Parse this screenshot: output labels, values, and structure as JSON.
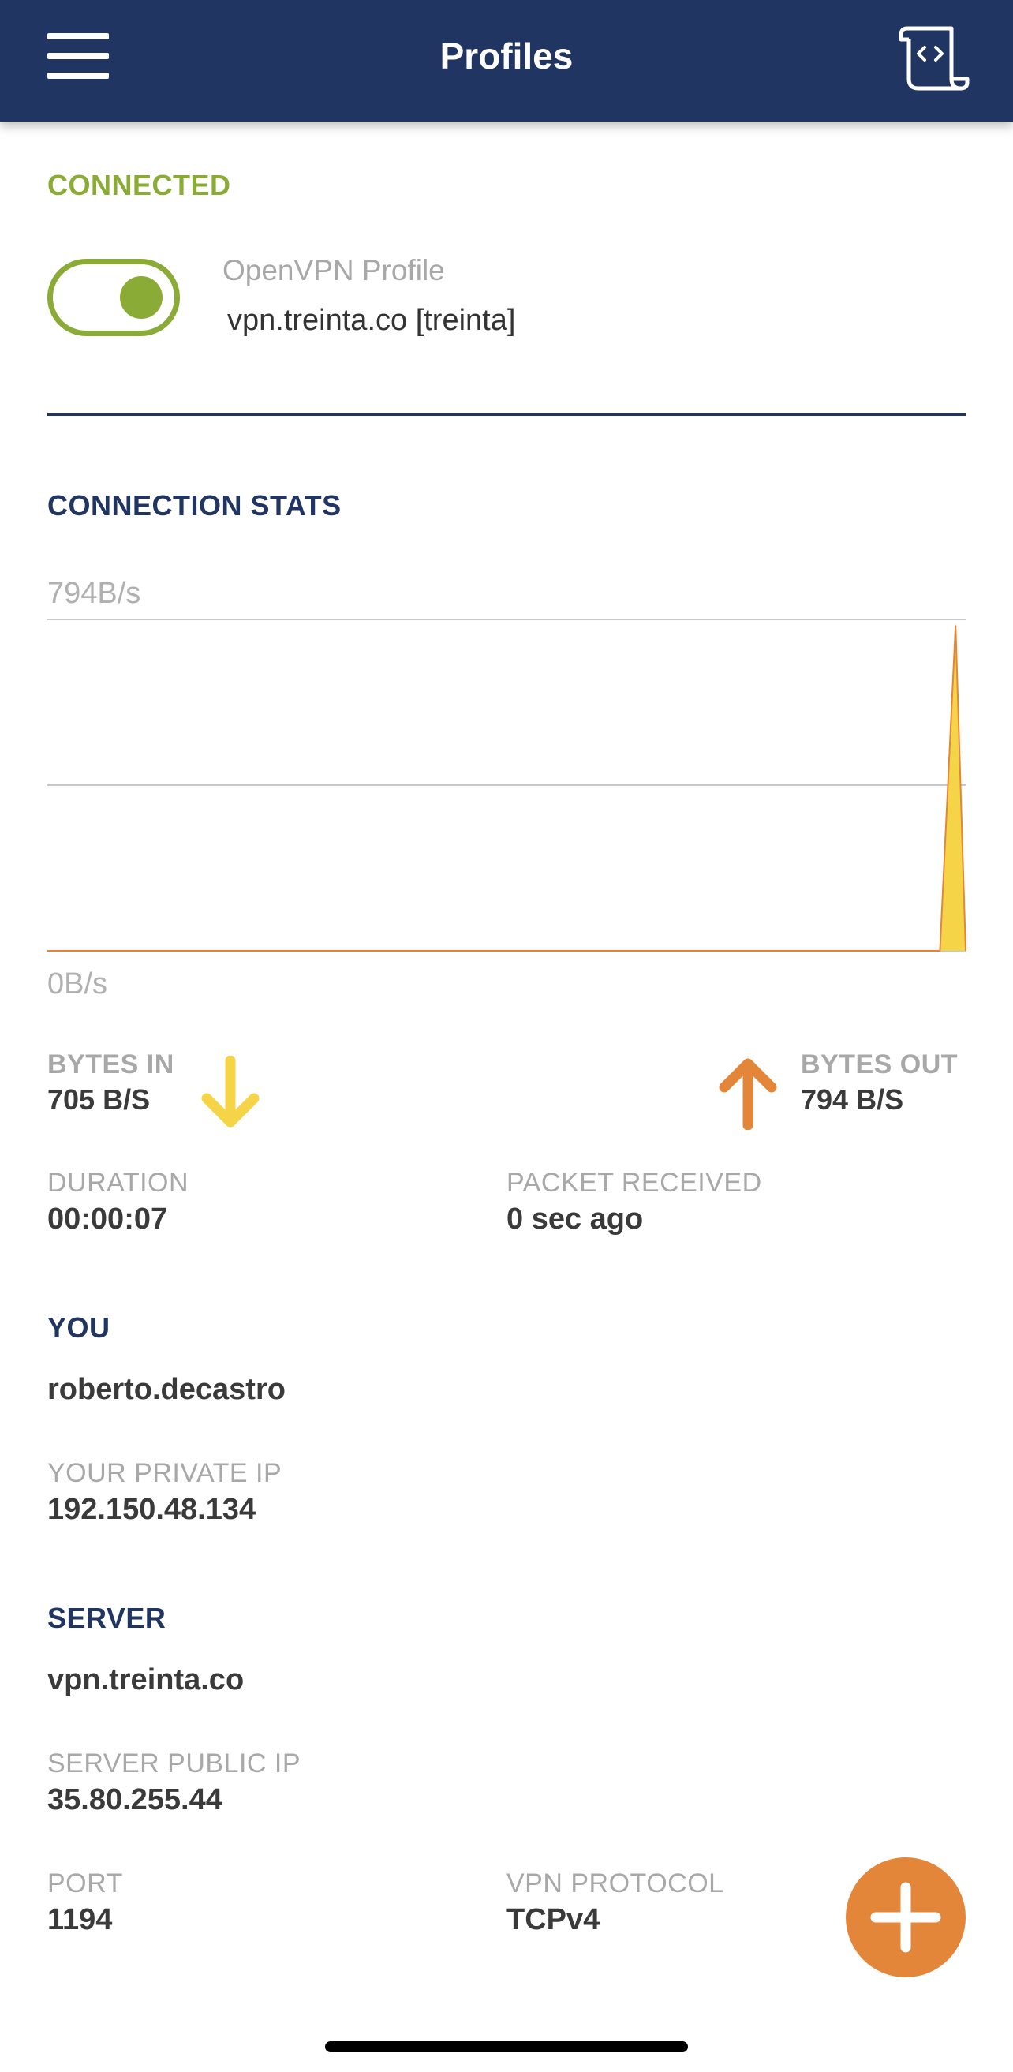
{
  "header": {
    "title": "Profiles"
  },
  "connection": {
    "status": "CONNECTED",
    "status_color": "#8aab35",
    "toggle_on": true,
    "profile_type": "OpenVPN Profile",
    "profile_name": "vpn.treinta.co [treinta]"
  },
  "stats": {
    "heading": "CONNECTION STATS",
    "max_label": "794B/s",
    "min_label": "0B/s",
    "bytes_in_label": "BYTES IN",
    "bytes_in_value": "705 B/S",
    "bytes_out_label": "BYTES OUT",
    "bytes_out_value": "794 B/S",
    "duration_label": "DURATION",
    "duration_value": "00:00:07",
    "packet_label": "PACKET RECEIVED",
    "packet_value": "0 sec ago"
  },
  "chart_data": {
    "type": "area",
    "ylim": [
      0,
      794
    ],
    "ytick_labels": [
      "794B/s",
      "0B/s"
    ],
    "grid": true,
    "series": [
      {
        "color": "#f5d547",
        "points": [
          {
            "t": 0.0,
            "v": 0
          },
          {
            "t": 0.972,
            "v": 0
          },
          {
            "t": 0.989,
            "v": 780
          },
          {
            "t": 1.0,
            "v": 0
          }
        ]
      }
    ]
  },
  "you": {
    "heading": "YOU",
    "username": "roberto.decastro",
    "private_ip_label": "YOUR PRIVATE IP",
    "private_ip_value": "192.150.48.134"
  },
  "server": {
    "heading": "SERVER",
    "hostname": "vpn.treinta.co",
    "public_ip_label": "SERVER PUBLIC IP",
    "public_ip_value": "35.80.255.44",
    "port_label": "PORT",
    "port_value": "1194",
    "protocol_label": "VPN PROTOCOL",
    "protocol_value": "TCPv4"
  },
  "colors": {
    "header_bg": "#213562",
    "section_heading": "#213562",
    "accent_green": "#8aab35",
    "bytes_in_arrow": "#f5d547",
    "bytes_out_arrow": "#e4863a",
    "fab": "#e4863a"
  },
  "icons": {
    "menu": "hamburger-menu-icon",
    "log": "log-scroll-icon",
    "bytes_in": "arrow-down-icon",
    "bytes_out": "arrow-up-icon",
    "fab": "plus-icon"
  }
}
